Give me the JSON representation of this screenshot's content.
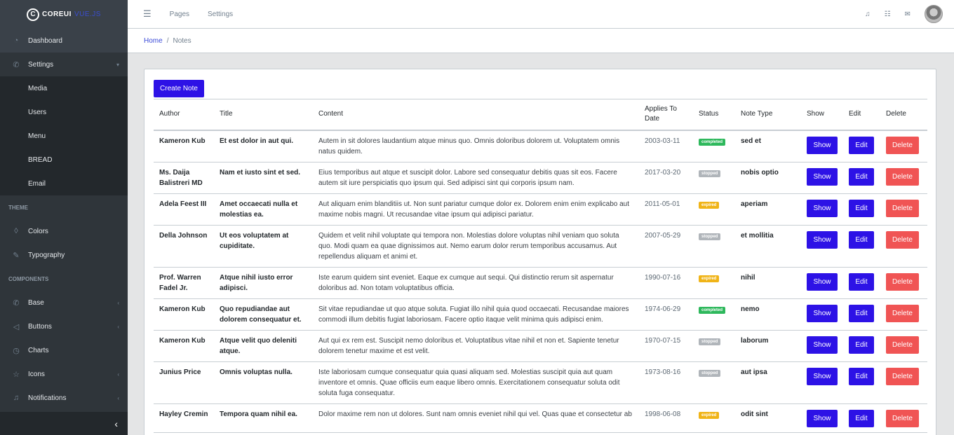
{
  "brand": {
    "logo_letter": "C",
    "name": "COREUI",
    "suffix": "VUE.JS"
  },
  "sidebar": {
    "items": [
      {
        "type": "item",
        "label": "Dashboard",
        "icon": "speedometer-icon",
        "glyph": "◔",
        "active": true
      },
      {
        "type": "item",
        "label": "Settings",
        "icon": "puzzle-icon",
        "glyph": "✆",
        "caret": "▾"
      },
      {
        "type": "sub",
        "label": "Media"
      },
      {
        "type": "sub",
        "label": "Users"
      },
      {
        "type": "sub",
        "label": "Menu"
      },
      {
        "type": "sub",
        "label": "BREAD"
      },
      {
        "type": "sub",
        "label": "Email"
      },
      {
        "type": "title",
        "label": "Theme"
      },
      {
        "type": "item",
        "label": "Colors",
        "icon": "drop-icon",
        "glyph": "◊"
      },
      {
        "type": "item",
        "label": "Typography",
        "icon": "pencil-icon",
        "glyph": "✎"
      },
      {
        "type": "title",
        "label": "Components"
      },
      {
        "type": "item",
        "label": "Base",
        "icon": "puzzle-icon",
        "glyph": "✆",
        "caret": "‹"
      },
      {
        "type": "item",
        "label": "Buttons",
        "icon": "cursor-icon",
        "glyph": "◁",
        "caret": "‹"
      },
      {
        "type": "item",
        "label": "Charts",
        "icon": "pie-chart-icon",
        "glyph": "◷"
      },
      {
        "type": "item",
        "label": "Icons",
        "icon": "star-icon",
        "glyph": "☆",
        "caret": "‹"
      },
      {
        "type": "item",
        "label": "Notifications",
        "icon": "bell-icon",
        "glyph": "♫",
        "caret": "‹"
      }
    ],
    "minimizer_glyph": "‹"
  },
  "header": {
    "menu_glyph": "☰",
    "links": [
      "Pages",
      "Settings"
    ],
    "bell_glyph": "♫",
    "list_glyph": "☷",
    "mail_glyph": "✉"
  },
  "breadcrumb": {
    "home": "Home",
    "separator": "/",
    "current": "Notes"
  },
  "notes": {
    "create_label": "Create Note",
    "columns": [
      "Author",
      "Title",
      "Content",
      "Applies To Date",
      "Status",
      "Note Type",
      "Show",
      "Edit",
      "Delete"
    ],
    "show_label": "Show",
    "edit_label": "Edit",
    "delete_label": "Delete",
    "status_colors": {
      "completed": "#2eb85c",
      "stopped": "#b0b5ba",
      "expired": "#f0b418"
    },
    "rows": [
      {
        "author": "Kameron Kub",
        "title": "Et est dolor in aut qui.",
        "content": "Autem in sit dolores laudantium atque minus quo. Omnis doloribus dolorem ut. Voluptatem omnis natus quidem.",
        "date": "2003-03-11",
        "status": "completed",
        "type": "sed et"
      },
      {
        "author": "Ms. Daija Balistreri MD",
        "title": "Nam et iusto sint et sed.",
        "content": "Eius temporibus aut atque et suscipit dolor. Labore sed consequatur debitis quas sit eos. Facere autem sit iure perspiciatis quo ipsum qui. Sed adipisci sint qui corporis ipsum nam.",
        "date": "2017-03-20",
        "status": "stopped",
        "type": "nobis optio"
      },
      {
        "author": "Adela Feest III",
        "title": "Amet occaecati nulla et molestias ea.",
        "content": "Aut aliquam enim blanditiis ut. Non sunt pariatur cumque dolor ex. Dolorem enim enim explicabo aut maxime nobis magni. Ut recusandae vitae ipsum qui adipisci pariatur.",
        "date": "2011-05-01",
        "status": "expired",
        "type": "aperiam"
      },
      {
        "author": "Della Johnson",
        "title": "Ut eos voluptatem at cupiditate.",
        "content": "Quidem et velit nihil voluptate qui tempora non. Molestias dolore voluptas nihil veniam quo soluta quo. Modi quam ea quae dignissimos aut. Nemo earum dolor rerum temporibus accusamus. Aut repellendus aliquam et animi et.",
        "date": "2007-05-29",
        "status": "stopped",
        "type": "et mollitia"
      },
      {
        "author": "Prof. Warren Fadel Jr.",
        "title": "Atque nihil iusto error adipisci.",
        "content": "Iste earum quidem sint eveniet. Eaque ex cumque aut sequi. Qui distinctio rerum sit aspernatur doloribus ad. Non totam voluptatibus officia.",
        "date": "1990-07-16",
        "status": "expired",
        "type": "nihil"
      },
      {
        "author": "Kameron Kub",
        "title": "Quo repudiandae aut dolorem consequatur et.",
        "content": "Sit vitae repudiandae ut quo atque soluta. Fugiat illo nihil quia quod occaecati. Recusandae maiores commodi illum debitis fugiat laboriosam. Facere optio itaque velit minima quis adipisci enim.",
        "date": "1974-06-29",
        "status": "completed",
        "type": "nemo"
      },
      {
        "author": "Kameron Kub",
        "title": "Atque velit quo deleniti atque.",
        "content": "Aut qui ex rem est. Suscipit nemo doloribus et. Voluptatibus vitae nihil et non et. Sapiente tenetur dolorem tenetur maxime et est velit.",
        "date": "1970-07-15",
        "status": "stopped",
        "type": "laborum"
      },
      {
        "author": "Junius Price",
        "title": "Omnis voluptas nulla.",
        "content": "Iste laboriosam cumque consequatur quia quasi aliquam sed. Molestias suscipit quia aut quam inventore et omnis. Quae officiis eum eaque libero omnis. Exercitationem consequatur soluta odit soluta fuga consequatur.",
        "date": "1973-08-16",
        "status": "stopped",
        "type": "aut ipsa"
      },
      {
        "author": "Hayley Cremin",
        "title": "Tempora quam nihil ea.",
        "content": "Dolor maxime rem non ut dolores. Sunt nam omnis eveniet nihil qui vel. Quas quae et consectetur ab",
        "date": "1998-06-08",
        "status": "expired",
        "type": "odit sint"
      }
    ]
  }
}
